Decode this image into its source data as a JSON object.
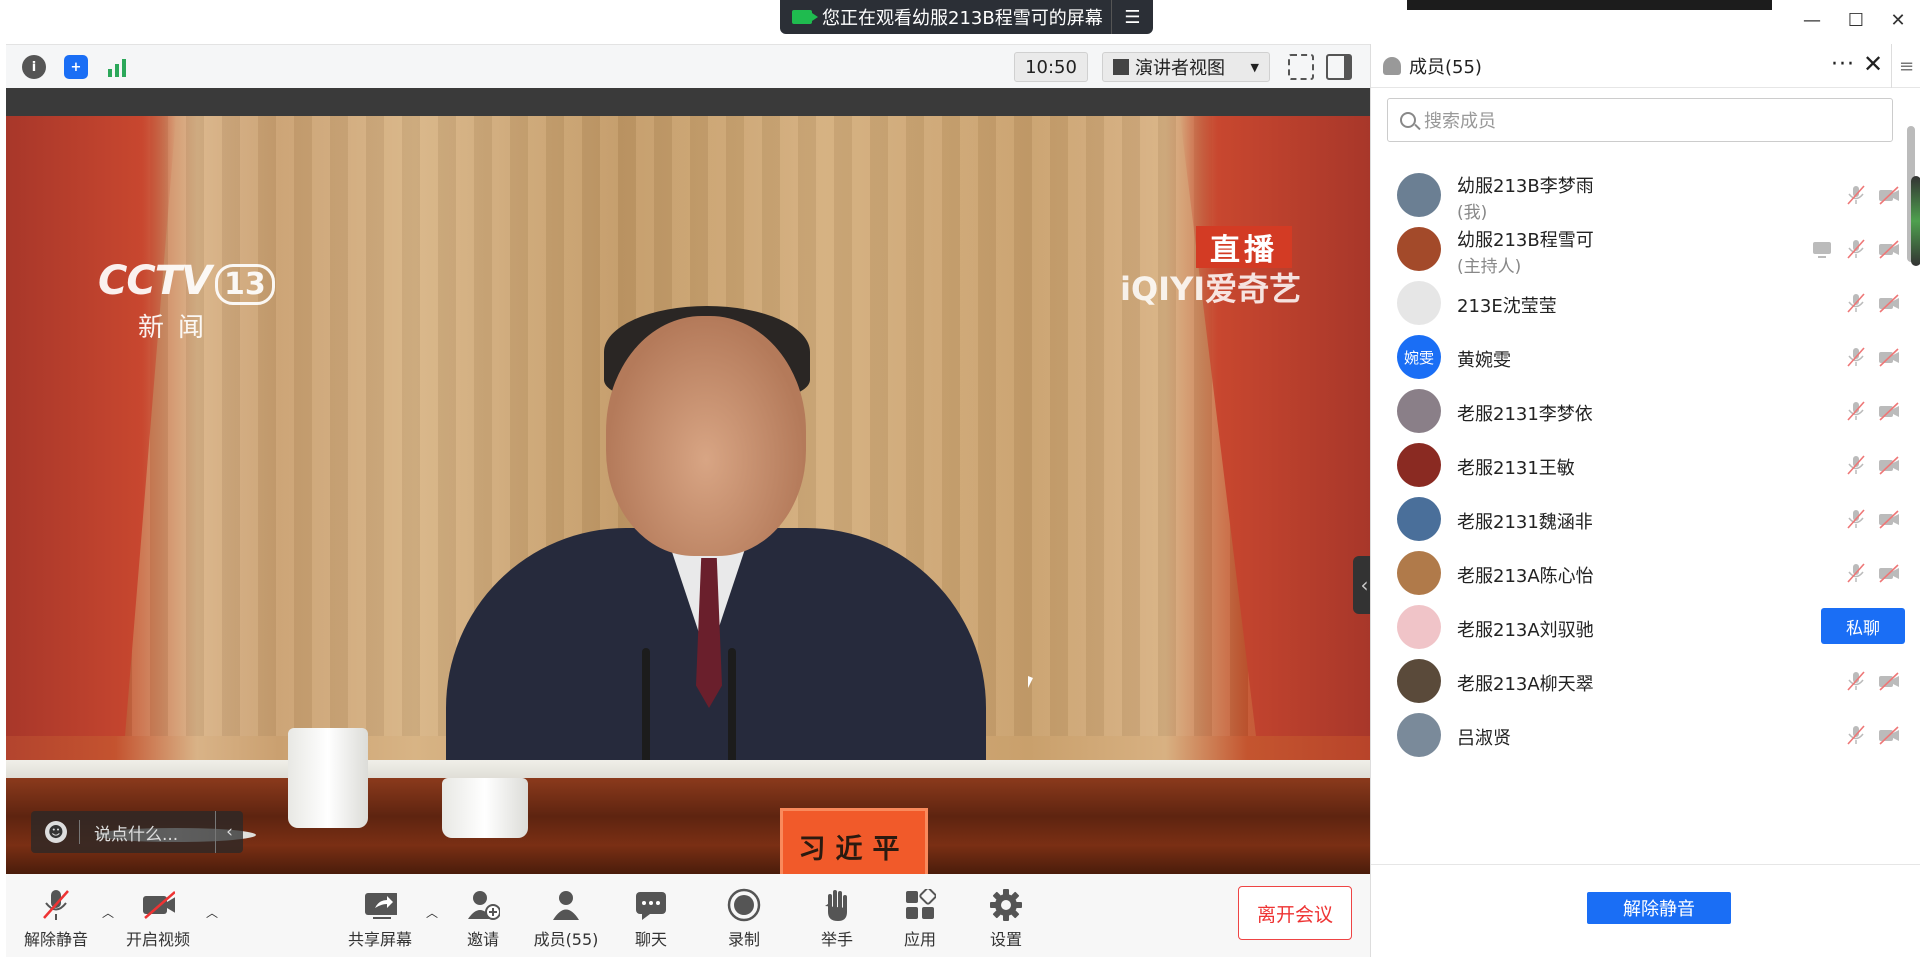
{
  "banner": {
    "text": "您正在观看幼服213B程雪可的屏幕",
    "menu_icon": "list-menu-icon"
  },
  "window": {
    "minimize": "—",
    "maximize": "☐",
    "close": "✕"
  },
  "topbar": {
    "time": "10:50",
    "view_mode": "演讲者视图"
  },
  "video": {
    "channel": "CCTV",
    "channel_num": "13",
    "channel_sub": "新闻",
    "live": "直播",
    "watermark": "iQIYI爱奇艺",
    "nameplate": "习近平",
    "comment_placeholder": "说点什么..."
  },
  "toolbar": {
    "mute": "解除静音",
    "video": "开启视频",
    "share": "共享屏幕",
    "invite": "邀请",
    "members": "成员(55)",
    "chat": "聊天",
    "record": "录制",
    "raise": "举手",
    "apps": "应用",
    "settings": "设置",
    "leave": "离开会议"
  },
  "panel": {
    "title": "成员(55)",
    "search_placeholder": "搜索成员",
    "unmute_button": "解除静音",
    "members": [
      {
        "name": "幼服213B李梦雨",
        "role": "(我)",
        "avatar_color": "#6b7f93",
        "avatar_text": ""
      },
      {
        "name": "幼服213B程雪可",
        "role": "(主持人)",
        "avatar_color": "#a34a2a",
        "avatar_text": ""
      },
      {
        "name": "213E沈莹莹",
        "role": "",
        "avatar_color": "#e6e6e6",
        "avatar_text": ""
      },
      {
        "name": "黄婉雯",
        "role": "",
        "avatar_color": "#1a6ef5",
        "avatar_text": "婉雯"
      },
      {
        "name": "老服2131李梦依",
        "role": "",
        "avatar_color": "#8a7f88",
        "avatar_text": ""
      },
      {
        "name": "老服2131王敏",
        "role": "",
        "avatar_color": "#8a2a22",
        "avatar_text": ""
      },
      {
        "name": "老服2131魏涵非",
        "role": "",
        "avatar_color": "#4a6f9a",
        "avatar_text": ""
      },
      {
        "name": "老服213A陈心怡",
        "role": "",
        "avatar_color": "#b07a4a",
        "avatar_text": ""
      },
      {
        "name": "老服213A刘驭驰",
        "role": "",
        "avatar_color": "#f0c4c8",
        "avatar_text": ""
      },
      {
        "name": "老服213A柳天翠",
        "role": "",
        "avatar_color": "#5a4a3a",
        "avatar_text": ""
      },
      {
        "name": "吕淑贤",
        "role": "",
        "avatar_color": "#7a8a9a",
        "avatar_text": ""
      }
    ],
    "private_chat": "私聊"
  }
}
